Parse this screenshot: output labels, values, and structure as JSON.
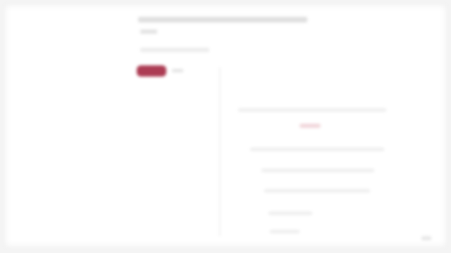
{
  "page": {
    "title": "",
    "subtitle": "",
    "meta": "",
    "primary_button": "",
    "secondary_text": ""
  },
  "panel": {
    "lines": [
      "",
      "",
      "",
      "",
      "",
      ""
    ]
  },
  "icons": {
    "corner": "corner-indicator-icon"
  },
  "colors": {
    "accent": "#a8324a",
    "background": "#ffffff"
  }
}
